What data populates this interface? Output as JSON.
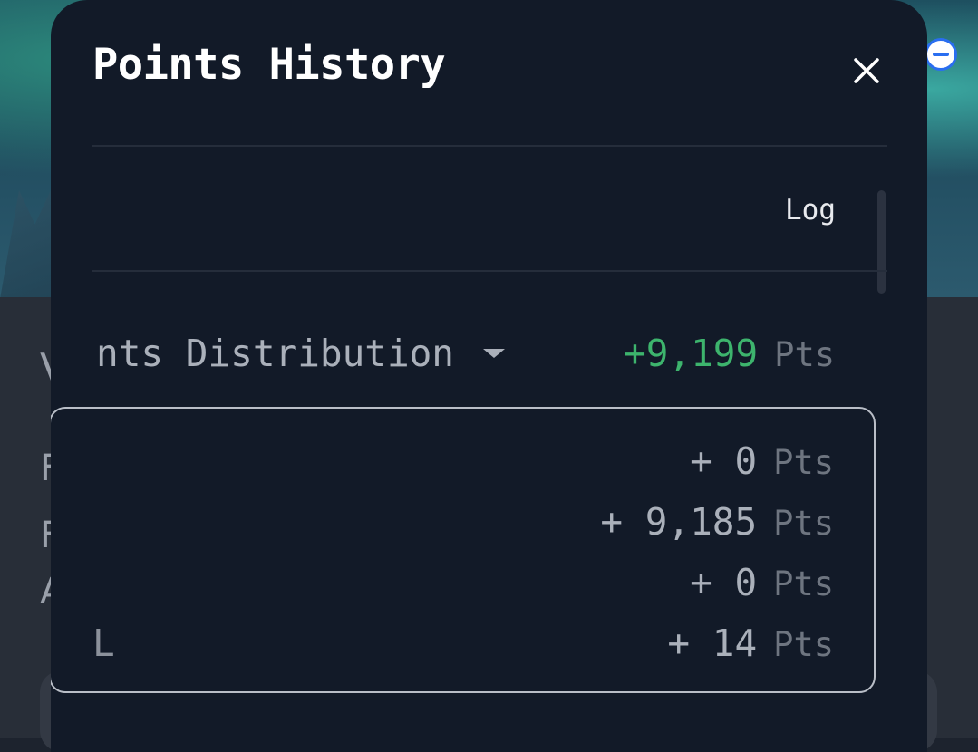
{
  "modal": {
    "title": "Points History",
    "tabs": [
      {
        "label": "Log"
      }
    ],
    "summary": {
      "label": "nts Distribution",
      "value": "+9,199",
      "unit": "Pts",
      "accent_color": "#3db46d"
    },
    "breakdown": [
      {
        "label": "",
        "value": "+ 0",
        "unit": "Pts"
      },
      {
        "label": "",
        "value": "+ 9,185",
        "unit": "Pts"
      },
      {
        "label": "",
        "value": "+ 0",
        "unit": "Pts"
      },
      {
        "label": "L",
        "value": "+ 14",
        "unit": "Pts"
      }
    ]
  },
  "background": {
    "text_lines": [
      "V",
      "F",
      "F",
      "A"
    ]
  }
}
